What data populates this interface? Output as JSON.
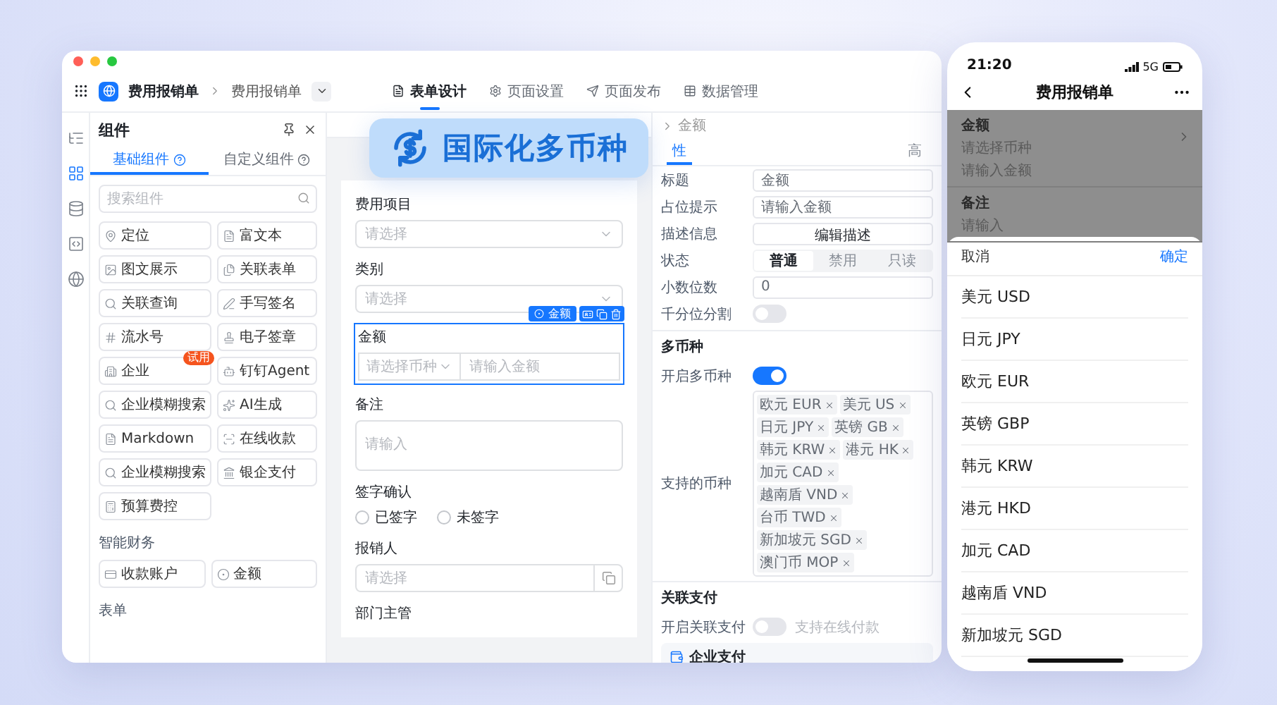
{
  "window": {
    "app_name": "费用报销单",
    "breadcrumb": "费用报销单",
    "tabs": [
      {
        "label": "表单设计",
        "selected": true
      },
      {
        "label": "页面设置",
        "selected": false
      },
      {
        "label": "页面发布",
        "selected": false
      },
      {
        "label": "数据管理",
        "selected": false
      }
    ]
  },
  "rail": [
    {
      "selected": false
    },
    {
      "selected": true
    },
    {
      "selected": false
    },
    {
      "selected": false
    },
    {
      "selected": false
    }
  ],
  "components_panel": {
    "title": "组件",
    "tabs": [
      {
        "label": "基础组件",
        "selected": true
      },
      {
        "label": "自定义组件",
        "selected": false
      }
    ],
    "search": {
      "placeholder": "搜索组件"
    },
    "groups": [
      {
        "items": [
          {
            "label": "定位"
          },
          {
            "label": "富文本"
          },
          {
            "label": "图文展示"
          },
          {
            "label": "关联表单"
          },
          {
            "label": "关联查询"
          },
          {
            "label": "手写签名"
          },
          {
            "label": "流水号"
          },
          {
            "label": "电子签章"
          },
          {
            "label": "企业",
            "badge": "试用"
          },
          {
            "label": "钉钉Agent"
          },
          {
            "label": "企业模糊搜索"
          },
          {
            "label": "AI生成"
          },
          {
            "label": "Markdown"
          },
          {
            "label": "在线收款"
          },
          {
            "label": "企业模糊搜索"
          },
          {
            "label": "银企支付"
          },
          {
            "label": "预算费控"
          }
        ]
      },
      {
        "heading": "智能财务",
        "items": [
          {
            "label": "收款账户"
          },
          {
            "label": "金额"
          }
        ]
      },
      {
        "heading": "表单"
      }
    ]
  },
  "badge": {
    "title": "国际化多币种"
  },
  "form": {
    "fields": [
      {
        "kind": "select",
        "label": "费用项目",
        "placeholder": "请选择",
        "selected": false
      },
      {
        "kind": "select",
        "label": "类别",
        "placeholder": "请选择",
        "selected": false
      },
      {
        "kind": "money",
        "label": "金额",
        "toolbar_label": "金额",
        "currency_placeholder": "请选择币种",
        "amount_placeholder": "请输入金额",
        "selected": true
      },
      {
        "kind": "textarea",
        "label": "备注",
        "placeholder": "请输入",
        "selected": false
      },
      {
        "kind": "radio",
        "label": "签字确认",
        "selected": false,
        "options": [
          {
            "label": "已签字",
            "selected": false
          },
          {
            "label": "未签字",
            "selected": false
          }
        ]
      },
      {
        "kind": "picker",
        "label": "报销人",
        "placeholder": "请选择",
        "selected": false
      },
      {
        "kind": "heading",
        "label": "部门主管",
        "selected": false
      }
    ]
  },
  "properties": {
    "breadcrumb": "金额",
    "tabs": [
      {
        "label": "性",
        "selected": true
      },
      {
        "label": "高",
        "selected": false
      }
    ],
    "rows": [
      {
        "kind": "input",
        "label": "标题",
        "value": "金额"
      },
      {
        "kind": "input",
        "label": "占位提示",
        "value": "请输入金额"
      },
      {
        "kind": "button",
        "label": "描述信息",
        "text": "编辑描述"
      },
      {
        "kind": "segmented",
        "label": "状态",
        "options": [
          {
            "label": "普通",
            "selected": true
          },
          {
            "label": "禁用",
            "selected": false
          },
          {
            "label": "只读",
            "selected": false
          }
        ]
      },
      {
        "kind": "input",
        "label": "小数位数",
        "value": "0"
      },
      {
        "kind": "switch",
        "label": "千分位分割",
        "on": false
      },
      {
        "kind": "section",
        "label": "多币种"
      },
      {
        "kind": "switch",
        "label": "开启多币种",
        "on": true
      },
      {
        "kind": "tags",
        "label": "支持的币种",
        "tags": [
          "欧元 EUR",
          "美元 US",
          "日元 JPY",
          "英镑 GB",
          "韩元 KRW",
          "港元 HK",
          "加元 CAD",
          "越南盾 VND",
          "台币 TWD",
          "新加坡元 SGD",
          "澳门币 MOP"
        ]
      },
      {
        "kind": "section",
        "label": "关联支付"
      },
      {
        "kind": "switch",
        "label": "开启关联支付",
        "on": false,
        "hint": "支持在线付款"
      },
      {
        "kind": "card",
        "label": "企业支付"
      }
    ]
  },
  "phone": {
    "time": "21:20",
    "network": "5G",
    "title": "费用报销单",
    "form": [
      {
        "label": "金额",
        "lines": [
          "请选择币种",
          "请输入金额"
        ]
      },
      {
        "label": "备注",
        "lines": [
          "请输入"
        ]
      }
    ],
    "sheet": {
      "cancel": "取消",
      "confirm": "确定",
      "options": [
        "美元 USD",
        "日元 JPY",
        "欧元 EUR",
        "英镑 GBP",
        "韩元 KRW",
        "港元 HKD",
        "加元 CAD",
        "越南盾 VND",
        "新加坡元 SGD"
      ]
    }
  }
}
